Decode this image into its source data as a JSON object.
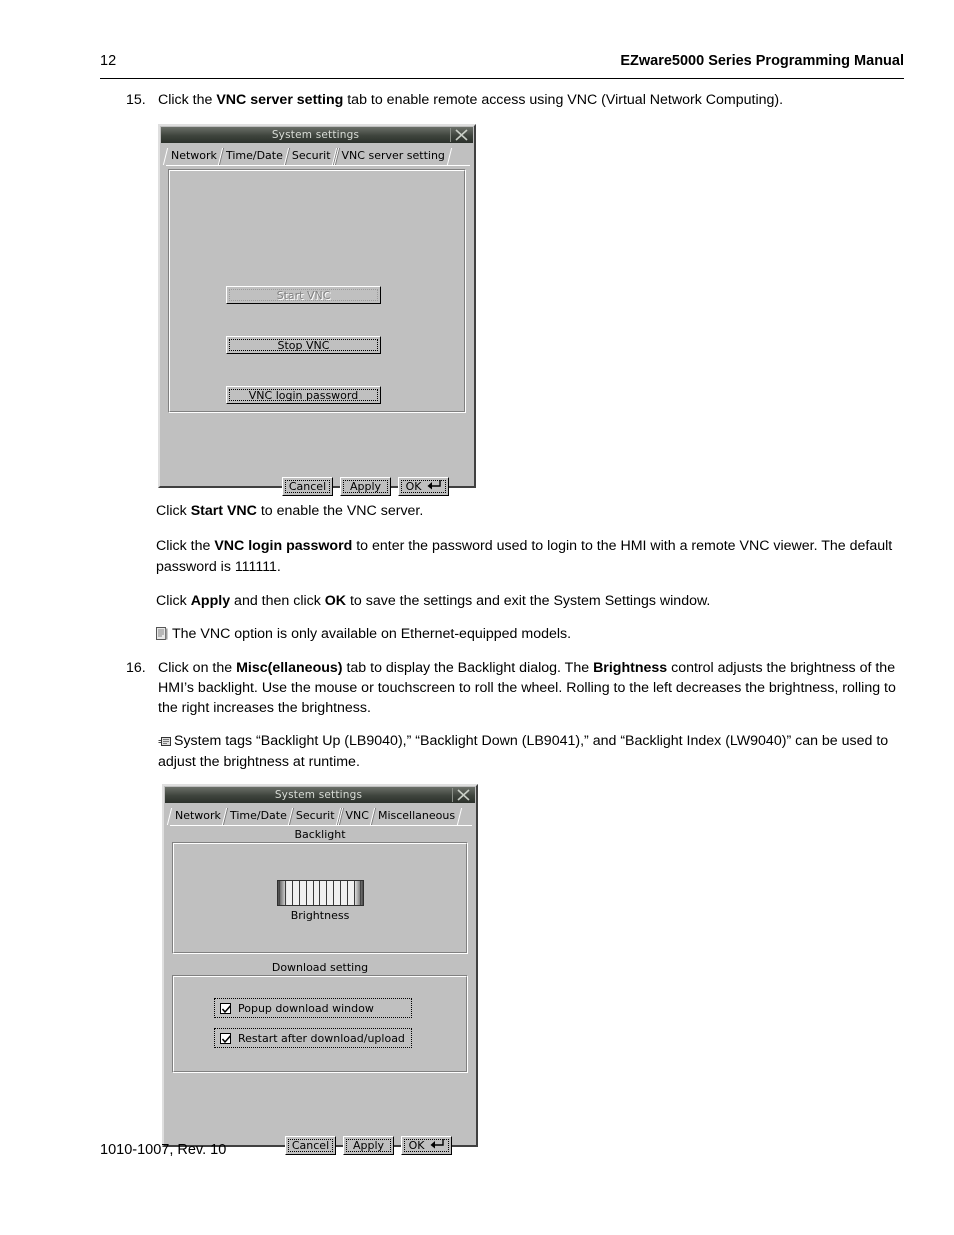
{
  "page": {
    "number": "12",
    "header_title": "EZware5000 Series Programming Manual",
    "footer": "1010-1007, Rev. 10"
  },
  "steps": [
    {
      "number": "15.",
      "text_parts": [
        "Click the ",
        "VNC server setting",
        " tab to enable remote access using VNC (Virtual Network Computing)."
      ]
    },
    {
      "number": "16.",
      "text_parts": [
        "Click on the ",
        "Misc(ellaneous)",
        " tab to display the Backlight dialog. The ",
        "Brightness",
        " control adjusts the brightness of the HMI’s backlight. Use the mouse or touchscreen to roll the wheel. Rolling to the left decreases the brightness, rolling to the right increases the brightness."
      ]
    }
  ],
  "paragraphs": {
    "p1": [
      "Click ",
      "Start VNC",
      " to enable the VNC server."
    ],
    "p2": [
      "Click the ",
      "VNC login password",
      " to enter the password used to login to the HMI with a remote VNC viewer. The default password is 111111."
    ],
    "p3": [
      "Click ",
      "Apply",
      " and then click ",
      "OK",
      " to save the settings and exit the System Settings window."
    ],
    "note1": "The VNC option is only available on Ethernet-equipped models.",
    "note2": "System tags “Backlight Up (LB9040),” “Backlight Down (LB9041),” and “Backlight Index (LW9040)” can be used to adjust the brightness at runtime."
  },
  "dialog_vnc": {
    "title": "System settings",
    "close_icon": "close-x-icon",
    "tabs": [
      {
        "label": "Network",
        "active": false
      },
      {
        "label": "Time/Date",
        "active": false
      },
      {
        "label": "Securit",
        "active": false
      },
      {
        "label": "VNC server setting",
        "active": true
      }
    ],
    "buttons": {
      "start_vnc": "Start VNC",
      "start_vnc_enabled": false,
      "stop_vnc": "Stop VNC",
      "vnc_login_password": "VNC login password"
    },
    "footer_buttons": {
      "cancel": "Cancel",
      "apply": "Apply",
      "ok": "OK",
      "ok_glyph": "enter-key-icon"
    }
  },
  "dialog_misc": {
    "title": "System settings",
    "close_icon": "close-x-icon",
    "tabs": [
      {
        "label": "Network",
        "active": false
      },
      {
        "label": "Time/Date",
        "active": false
      },
      {
        "label": "Securit",
        "active": false
      },
      {
        "label": "VNC",
        "active": false
      },
      {
        "label": "Miscellaneous",
        "active": true
      }
    ],
    "backlight": {
      "caption": "Backlight",
      "wheel_label": "Brightness",
      "wheel_ticks": 13
    },
    "download_setting": {
      "caption": "Download setting",
      "checkboxes": [
        {
          "label": "Popup download window",
          "checked": true
        },
        {
          "label": "Restart after download/upload",
          "checked": true
        }
      ]
    },
    "footer_buttons": {
      "cancel": "Cancel",
      "apply": "Apply",
      "ok": "OK",
      "ok_glyph": "enter-key-icon"
    }
  }
}
